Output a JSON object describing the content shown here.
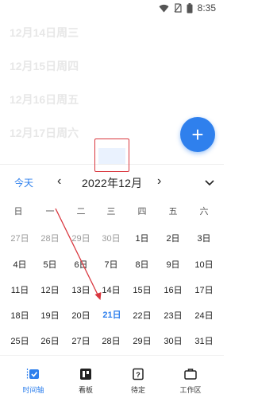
{
  "status_bar": {
    "time": "8:35",
    "icons": [
      "wifi-icon",
      "no-sim-icon",
      "battery-icon"
    ]
  },
  "timeline": {
    "days": [
      "12月14日周三",
      "12月15日周四",
      "12月16日周五",
      "12月17日周六"
    ]
  },
  "fab": {
    "label": "+"
  },
  "calendar": {
    "today_label": "今天",
    "prev_label": "‹",
    "month_title": "2022年12月",
    "next_label": "›",
    "weekdays": [
      "日",
      "一",
      "二",
      "三",
      "四",
      "五",
      "六"
    ],
    "weeks": [
      [
        "27日",
        "28日",
        "29日",
        "30日",
        "1日",
        "2日",
        "3日"
      ],
      [
        "4日",
        "5日",
        "6日",
        "7日",
        "8日",
        "9日",
        "10日"
      ],
      [
        "11日",
        "12日",
        "13日",
        "14日",
        "15日",
        "16日",
        "17日"
      ],
      [
        "18日",
        "19日",
        "20日",
        "21日",
        "22日",
        "23日",
        "24日"
      ],
      [
        "25日",
        "26日",
        "27日",
        "28日",
        "29日",
        "30日",
        "31日"
      ]
    ],
    "selected": "21日"
  },
  "bottom_nav": {
    "items": [
      {
        "label": "时间轴",
        "icon": "timeline-icon",
        "active": true
      },
      {
        "label": "看板",
        "icon": "board-icon",
        "active": false
      },
      {
        "label": "待定",
        "icon": "pending-icon",
        "active": false
      },
      {
        "label": "工作区",
        "icon": "workspace-icon",
        "active": false
      }
    ]
  },
  "colors": {
    "accent": "#2f80ed",
    "annotation_red": "#d9363e"
  }
}
